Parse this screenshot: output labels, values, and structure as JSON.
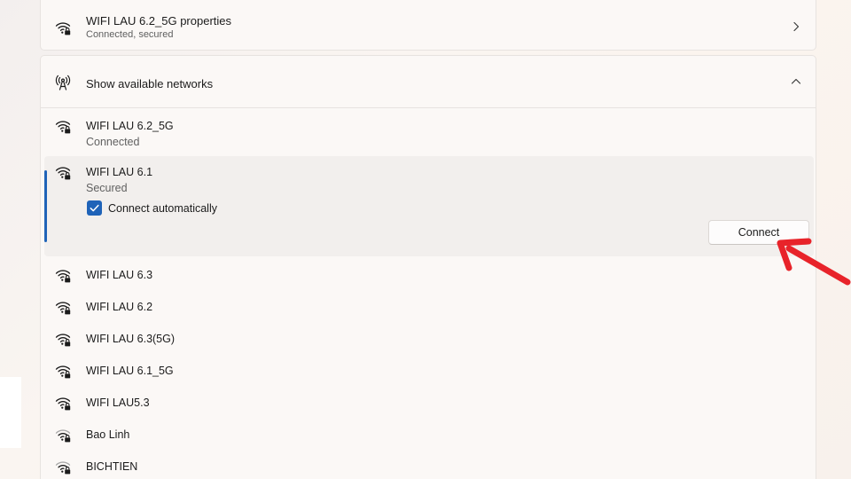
{
  "properties_card": {
    "title": "WIFI LAU 6.2_5G properties",
    "subtitle": "Connected, secured",
    "icon": "wifi-lock-icon",
    "chevron": "chevron-right-icon"
  },
  "available": {
    "header_label": "Show available networks",
    "header_icon": "antenna-icon",
    "chevron": "chevron-up-icon"
  },
  "connected_network": {
    "name": "WIFI LAU 6.2_5G",
    "status": "Connected"
  },
  "selected_network": {
    "name": "WIFI LAU 6.1",
    "status": "Secured",
    "connect_auto_label": "Connect automatically",
    "connect_auto_checked": true,
    "connect_button": "Connect"
  },
  "networks": [
    {
      "name": "WIFI LAU 6.3"
    },
    {
      "name": "WIFI LAU 6.2"
    },
    {
      "name": "WIFI LAU 6.3(5G)"
    },
    {
      "name": "WIFI LAU 6.1_5G"
    },
    {
      "name": "WIFI LAU5.3"
    },
    {
      "name": "Bao Linh"
    },
    {
      "name": "BICHTIEN"
    }
  ],
  "colors": {
    "accent": "#1f63b8",
    "annotation_arrow": "#e8232a"
  }
}
